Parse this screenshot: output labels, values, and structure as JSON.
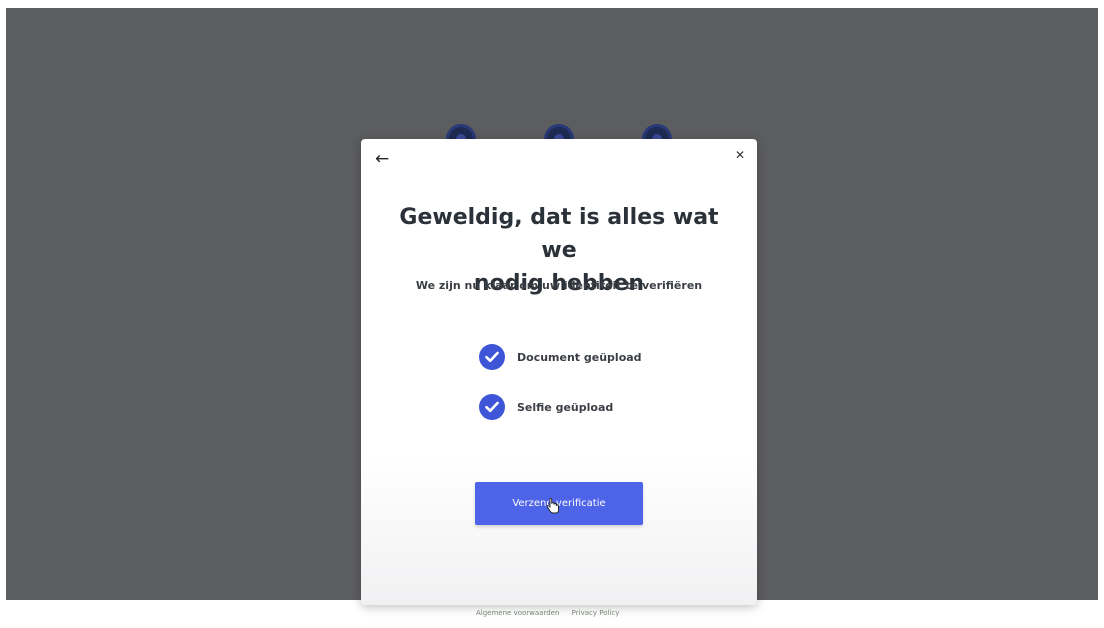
{
  "modal": {
    "back_icon": "arrow-left-icon",
    "close_icon": "close-icon",
    "title_line1": "Geweldig, dat is alles wat we",
    "title_line2": "nodig hebben",
    "subtitle": "We zijn nu klaar om uw identiteit te verifiëren",
    "checklist": [
      {
        "label": "Document geüpload",
        "icon": "check-circle-icon",
        "done": true
      },
      {
        "label": "Selfie geüpload",
        "icon": "check-circle-icon",
        "done": true
      }
    ],
    "submit_label": "Verzend verificatie"
  },
  "footer": {
    "terms_label": "Algemene voorwaarden",
    "privacy_label": "Privacy Policy"
  },
  "colors": {
    "accent": "#4d63e8",
    "check": "#3d55d6",
    "backdrop": "#5c5d5f",
    "step_dot": "#1e2a52"
  },
  "steps": [
    {
      "icon": "step-indicator-icon"
    },
    {
      "icon": "step-indicator-icon"
    },
    {
      "icon": "step-indicator-icon"
    }
  ]
}
